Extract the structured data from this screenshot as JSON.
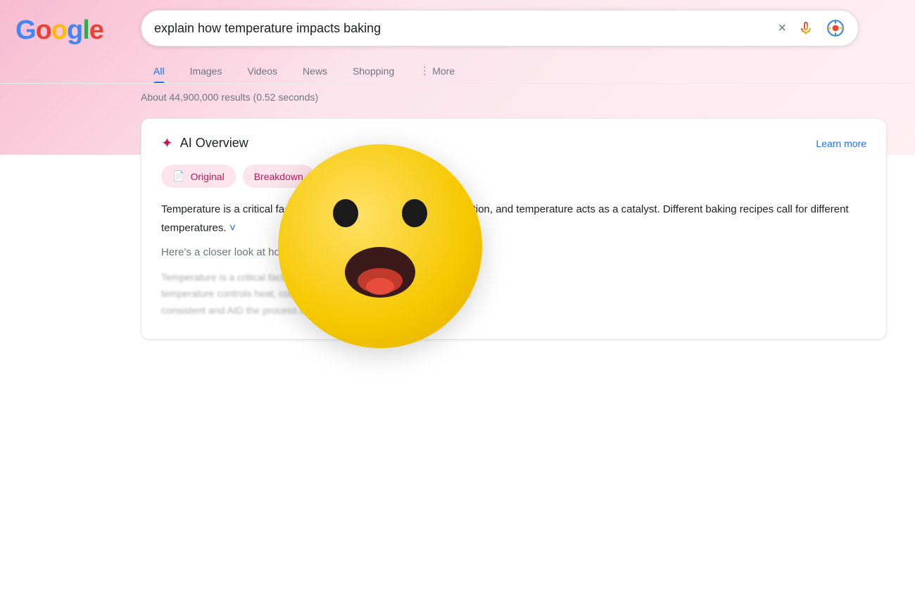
{
  "background": {
    "topColor": "#fce4ec",
    "bottomColor": "#ffffff"
  },
  "logo": {
    "letters": [
      {
        "char": "G",
        "color": "blue"
      },
      {
        "char": "o",
        "color": "red"
      },
      {
        "char": "o",
        "color": "yellow"
      },
      {
        "char": "g",
        "color": "blue"
      },
      {
        "char": "l",
        "color": "green"
      },
      {
        "char": "e",
        "color": "red"
      }
    ]
  },
  "searchbar": {
    "query": "explain how temperature impacts baking",
    "clear_label": "×",
    "mic_title": "Search by voice",
    "lens_title": "Search by image"
  },
  "nav": {
    "tabs": [
      {
        "label": "All",
        "active": true
      },
      {
        "label": "Images",
        "active": false
      },
      {
        "label": "Videos",
        "active": false
      },
      {
        "label": "News",
        "active": false
      },
      {
        "label": "Shopping",
        "active": false
      }
    ],
    "more_label": "More"
  },
  "results": {
    "count_text": "About 44,900,000 results (0.52 seconds)"
  },
  "ai_overview": {
    "title": "AI Overview",
    "learn_more": "Learn more",
    "pill_original": "Original",
    "pill_breakdown": "Breakdown",
    "content_main": "Temperature is a critical factor in baking. Baking is a chemical reaction, and temperature acts as a catalyst. Different baking recipes call for different temperatures.",
    "expand_hint": "˅",
    "closer_look": "Here's a closer look at how temperature impacts baking:",
    "blurred_line1": "Temperature is a critical factor in baking.",
    "blurred_line2": "temperature controls heat, color and moisture. It helps to keep the food",
    "blurred_line3": "consistent and AID the process and give the right flavour"
  },
  "emoji": {
    "label": "Surprised face emoji",
    "unicode": "😱"
  }
}
